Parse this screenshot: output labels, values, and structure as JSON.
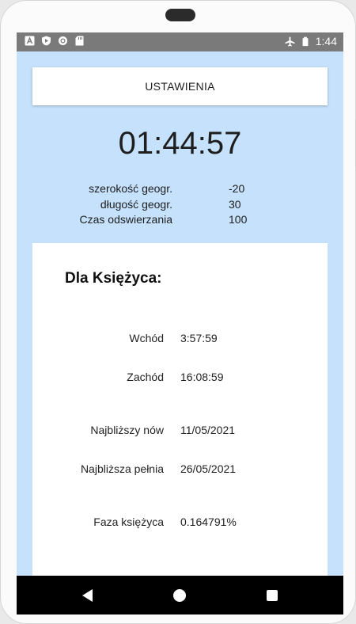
{
  "statusbar": {
    "time": "1:44",
    "icons": [
      "a-box-icon",
      "play-protect-icon",
      "circle-icon",
      "sd-card-icon",
      "airplane-icon",
      "battery-icon"
    ]
  },
  "settings": {
    "button_label": "USTAWIENIA"
  },
  "clock": {
    "time": "01:44:57"
  },
  "coords": [
    {
      "label": "szerokość geogr.",
      "value": "-20"
    },
    {
      "label": "długość geogr.",
      "value": "30"
    },
    {
      "label": "Czas odswierzania",
      "value": "100"
    }
  ],
  "moon": {
    "title": "Dla Księżyca:",
    "rows": [
      {
        "label": "Wchód",
        "value": "3:57:59"
      },
      {
        "label": "Zachód",
        "value": "16:08:59"
      },
      {
        "label": "Najbliższy nów",
        "value": "11/05/2021"
      },
      {
        "label": "Najbliższa pełnia",
        "value": "26/05/2021"
      },
      {
        "label": "Faza księżyca",
        "value": "0.164791%"
      }
    ]
  },
  "colors": {
    "background": "#c5e1fb",
    "card": "#ffffff",
    "statusbar": "#7a7a7a",
    "navbar": "#000000"
  }
}
